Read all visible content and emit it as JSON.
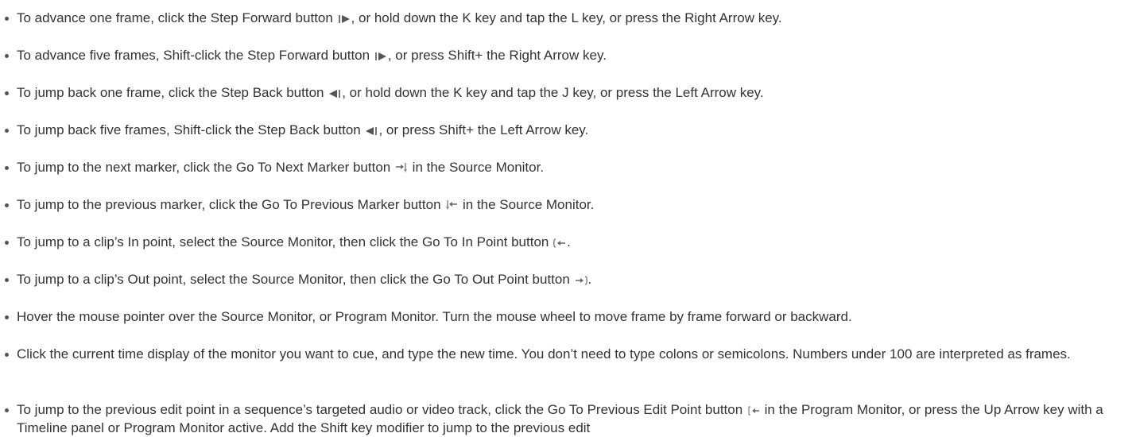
{
  "items": [
    {
      "before": "To advance one frame, click the Step Forward button ",
      "icon": "step-forward-icon",
      "after": ", or hold down the K key and tap the L key, or press the Right Arrow key."
    },
    {
      "before": "To advance five frames, Shift-click the Step Forward button ",
      "icon": "step-forward-icon",
      "after": ", or press Shift+ the Right Arrow key."
    },
    {
      "before": "To jump back one frame, click the Step Back button ",
      "icon": "step-back-icon",
      "after": ", or hold down the K key and tap the J key, or press the Left Arrow key."
    },
    {
      "before": "To jump back five frames, Shift-click the Step Back button ",
      "icon": "step-back-icon",
      "after": ", or press Shift+ the Left Arrow key."
    },
    {
      "before": "To jump to the next marker, click the Go To Next Marker button ",
      "icon": "go-to-next-marker-icon",
      "after": " in the Source Monitor."
    },
    {
      "before": "To jump to the previous marker, click the Go To Previous Marker button ",
      "icon": "go-to-previous-marker-icon",
      "after": " in the Source Monitor."
    },
    {
      "before": "To jump to a clip’s In point, select the Source Monitor, then click the Go To In Point button ",
      "icon": "go-to-in-point-icon",
      "after": "."
    },
    {
      "before": "To jump to a clip’s Out point, select the Source Monitor, then click the Go To Out Point button ",
      "icon": "go-to-out-point-icon",
      "after": "."
    },
    {
      "before": "Hover the mouse pointer over the Source Monitor, or Program Monitor. Turn the mouse wheel to move frame by frame forward or backward.",
      "icon": "",
      "after": ""
    },
    {
      "before": "Click the current time display of the monitor you want to cue, and type the new time. You don’t need to type colons or semicolons. Numbers under 100 are interpreted as frames.",
      "icon": "",
      "after": ""
    },
    {
      "before": "To jump to the previous edit point in a sequence’s targeted audio or video track, click the Go To Previous Edit Point button ",
      "icon": "go-to-previous-edit-point-icon",
      "after": " in the Program Monitor, or press the Up Arrow key with a Timeline panel or Program Monitor active. Add the Shift key modifier to jump to the previous edit"
    }
  ]
}
